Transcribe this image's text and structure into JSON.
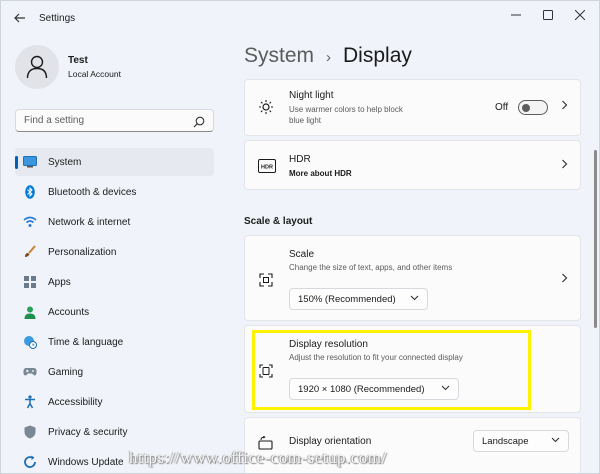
{
  "window": {
    "title": "Settings",
    "controls": {
      "minimize": "—",
      "maximize": "☐",
      "close": "✕"
    }
  },
  "profile": {
    "name": "Test",
    "account": "Local Account"
  },
  "search": {
    "placeholder": "Find a setting"
  },
  "sidebar": {
    "items": [
      {
        "label": "System",
        "icon": "system-icon",
        "active": true
      },
      {
        "label": "Bluetooth & devices",
        "icon": "bluetooth-icon"
      },
      {
        "label": "Network & internet",
        "icon": "wifi-icon"
      },
      {
        "label": "Personalization",
        "icon": "brush-icon"
      },
      {
        "label": "Apps",
        "icon": "apps-icon"
      },
      {
        "label": "Accounts",
        "icon": "accounts-icon"
      },
      {
        "label": "Time & language",
        "icon": "globe-clock-icon"
      },
      {
        "label": "Gaming",
        "icon": "gaming-icon"
      },
      {
        "label": "Accessibility",
        "icon": "accessibility-icon"
      },
      {
        "label": "Privacy & security",
        "icon": "shield-icon"
      },
      {
        "label": "Windows Update",
        "icon": "update-icon"
      }
    ]
  },
  "breadcrumb": {
    "parent": "System",
    "separator": "›",
    "current": "Display"
  },
  "main": {
    "night_light": {
      "title": "Night light",
      "desc": "Use warmer colors to help block blue light",
      "toggle_label": "Off",
      "toggle_on": false
    },
    "hdr": {
      "title": "HDR",
      "link": "More about HDR"
    },
    "section_scale": "Scale & layout",
    "scale": {
      "title": "Scale",
      "desc": "Change the size of text, apps, and other items",
      "value": "150% (Recommended)"
    },
    "resolution": {
      "title": "Display resolution",
      "desc": "Adjust the resolution to fit your connected display",
      "value": "1920 × 1080 (Recommended)"
    },
    "orientation": {
      "title": "Display orientation",
      "value": "Landscape"
    }
  },
  "watermark": "https://www.office-com-setup.com/",
  "colors": {
    "accent": "#005fb8",
    "highlight": "#fff200",
    "background": "#f0f3f9"
  }
}
